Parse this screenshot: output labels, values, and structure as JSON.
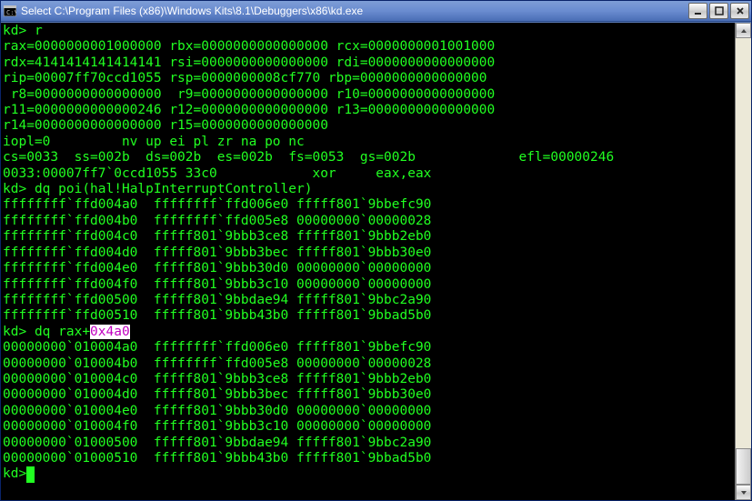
{
  "window": {
    "title": "Select C:\\Program Files (x86)\\Windows Kits\\8.1\\Debuggers\\x86\\kd.exe"
  },
  "prompt": "kd>",
  "commands": {
    "c1": "r",
    "c2": "dq poi(hal!HalpInterruptController)",
    "c3_prefix": "dq rax+",
    "c3_selected": "0x4a0"
  },
  "registers_block": [
    "rax=0000000001000000 rbx=0000000000000000 rcx=0000000001001000",
    "rdx=4141414141414141 rsi=0000000000000000 rdi=0000000000000000",
    "rip=00007ff70ccd1055 rsp=0000000008cf770 rbp=0000000000000000",
    " r8=0000000000000000  r9=0000000000000000 r10=0000000000000000",
    "r11=0000000000000246 r12=0000000000000000 r13=0000000000000000",
    "r14=0000000000000000 r15=0000000000000000"
  ],
  "flags_line1": "iopl=0         nv up ei pl zr na po nc",
  "flags_line2_left": "cs=0033  ss=002b  ds=002b  es=002b  fs=0053  gs=002b",
  "flags_line2_right": "efl=00000246",
  "disasm": "0033:00007ff7`0ccd1055 33c0            xor     eax,eax",
  "dump1": [
    "ffffffff`ffd004a0  ffffffff`ffd006e0 fffff801`9bbefc90",
    "ffffffff`ffd004b0  ffffffff`ffd005e8 00000000`00000028",
    "ffffffff`ffd004c0  fffff801`9bbb3ce8 fffff801`9bbb2eb0",
    "ffffffff`ffd004d0  fffff801`9bbb3bec fffff801`9bbb30e0",
    "ffffffff`ffd004e0  fffff801`9bbb30d0 00000000`00000000",
    "ffffffff`ffd004f0  fffff801`9bbb3c10 00000000`00000000",
    "ffffffff`ffd00500  fffff801`9bbdae94 fffff801`9bbc2a90",
    "ffffffff`ffd00510  fffff801`9bbb43b0 fffff801`9bbad5b0"
  ],
  "dump2": [
    "00000000`010004a0  ffffffff`ffd006e0 fffff801`9bbefc90",
    "00000000`010004b0  ffffffff`ffd005e8 00000000`00000028",
    "00000000`010004c0  fffff801`9bbb3ce8 fffff801`9bbb2eb0",
    "00000000`010004d0  fffff801`9bbb3bec fffff801`9bbb30e0",
    "00000000`010004e0  fffff801`9bbb30d0 00000000`00000000",
    "00000000`010004f0  fffff801`9bbb3c10 00000000`00000000",
    "00000000`01000500  fffff801`9bbdae94 fffff801`9bbc2a90",
    "00000000`01000510  fffff801`9bbb43b0 fffff801`9bbad5b0"
  ],
  "cursor": " "
}
